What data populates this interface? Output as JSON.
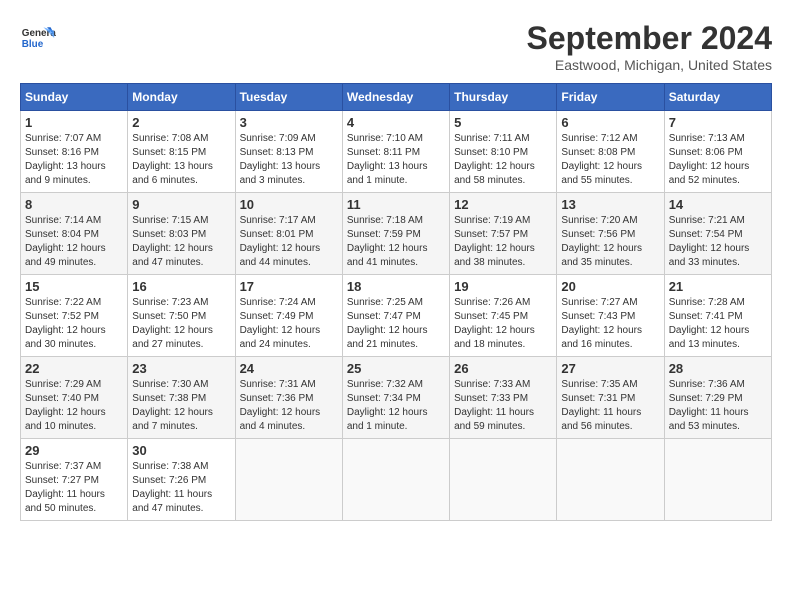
{
  "header": {
    "logo_line1": "General",
    "logo_line2": "Blue",
    "month": "September 2024",
    "location": "Eastwood, Michigan, United States"
  },
  "columns": [
    "Sunday",
    "Monday",
    "Tuesday",
    "Wednesday",
    "Thursday",
    "Friday",
    "Saturday"
  ],
  "weeks": [
    [
      {
        "day": "1",
        "detail": "Sunrise: 7:07 AM\nSunset: 8:16 PM\nDaylight: 13 hours\nand 9 minutes."
      },
      {
        "day": "2",
        "detail": "Sunrise: 7:08 AM\nSunset: 8:15 PM\nDaylight: 13 hours\nand 6 minutes."
      },
      {
        "day": "3",
        "detail": "Sunrise: 7:09 AM\nSunset: 8:13 PM\nDaylight: 13 hours\nand 3 minutes."
      },
      {
        "day": "4",
        "detail": "Sunrise: 7:10 AM\nSunset: 8:11 PM\nDaylight: 13 hours\nand 1 minute."
      },
      {
        "day": "5",
        "detail": "Sunrise: 7:11 AM\nSunset: 8:10 PM\nDaylight: 12 hours\nand 58 minutes."
      },
      {
        "day": "6",
        "detail": "Sunrise: 7:12 AM\nSunset: 8:08 PM\nDaylight: 12 hours\nand 55 minutes."
      },
      {
        "day": "7",
        "detail": "Sunrise: 7:13 AM\nSunset: 8:06 PM\nDaylight: 12 hours\nand 52 minutes."
      }
    ],
    [
      {
        "day": "8",
        "detail": "Sunrise: 7:14 AM\nSunset: 8:04 PM\nDaylight: 12 hours\nand 49 minutes."
      },
      {
        "day": "9",
        "detail": "Sunrise: 7:15 AM\nSunset: 8:03 PM\nDaylight: 12 hours\nand 47 minutes."
      },
      {
        "day": "10",
        "detail": "Sunrise: 7:17 AM\nSunset: 8:01 PM\nDaylight: 12 hours\nand 44 minutes."
      },
      {
        "day": "11",
        "detail": "Sunrise: 7:18 AM\nSunset: 7:59 PM\nDaylight: 12 hours\nand 41 minutes."
      },
      {
        "day": "12",
        "detail": "Sunrise: 7:19 AM\nSunset: 7:57 PM\nDaylight: 12 hours\nand 38 minutes."
      },
      {
        "day": "13",
        "detail": "Sunrise: 7:20 AM\nSunset: 7:56 PM\nDaylight: 12 hours\nand 35 minutes."
      },
      {
        "day": "14",
        "detail": "Sunrise: 7:21 AM\nSunset: 7:54 PM\nDaylight: 12 hours\nand 33 minutes."
      }
    ],
    [
      {
        "day": "15",
        "detail": "Sunrise: 7:22 AM\nSunset: 7:52 PM\nDaylight: 12 hours\nand 30 minutes."
      },
      {
        "day": "16",
        "detail": "Sunrise: 7:23 AM\nSunset: 7:50 PM\nDaylight: 12 hours\nand 27 minutes."
      },
      {
        "day": "17",
        "detail": "Sunrise: 7:24 AM\nSunset: 7:49 PM\nDaylight: 12 hours\nand 24 minutes."
      },
      {
        "day": "18",
        "detail": "Sunrise: 7:25 AM\nSunset: 7:47 PM\nDaylight: 12 hours\nand 21 minutes."
      },
      {
        "day": "19",
        "detail": "Sunrise: 7:26 AM\nSunset: 7:45 PM\nDaylight: 12 hours\nand 18 minutes."
      },
      {
        "day": "20",
        "detail": "Sunrise: 7:27 AM\nSunset: 7:43 PM\nDaylight: 12 hours\nand 16 minutes."
      },
      {
        "day": "21",
        "detail": "Sunrise: 7:28 AM\nSunset: 7:41 PM\nDaylight: 12 hours\nand 13 minutes."
      }
    ],
    [
      {
        "day": "22",
        "detail": "Sunrise: 7:29 AM\nSunset: 7:40 PM\nDaylight: 12 hours\nand 10 minutes."
      },
      {
        "day": "23",
        "detail": "Sunrise: 7:30 AM\nSunset: 7:38 PM\nDaylight: 12 hours\nand 7 minutes."
      },
      {
        "day": "24",
        "detail": "Sunrise: 7:31 AM\nSunset: 7:36 PM\nDaylight: 12 hours\nand 4 minutes."
      },
      {
        "day": "25",
        "detail": "Sunrise: 7:32 AM\nSunset: 7:34 PM\nDaylight: 12 hours\nand 1 minute."
      },
      {
        "day": "26",
        "detail": "Sunrise: 7:33 AM\nSunset: 7:33 PM\nDaylight: 11 hours\nand 59 minutes."
      },
      {
        "day": "27",
        "detail": "Sunrise: 7:35 AM\nSunset: 7:31 PM\nDaylight: 11 hours\nand 56 minutes."
      },
      {
        "day": "28",
        "detail": "Sunrise: 7:36 AM\nSunset: 7:29 PM\nDaylight: 11 hours\nand 53 minutes."
      }
    ],
    [
      {
        "day": "29",
        "detail": "Sunrise: 7:37 AM\nSunset: 7:27 PM\nDaylight: 11 hours\nand 50 minutes."
      },
      {
        "day": "30",
        "detail": "Sunrise: 7:38 AM\nSunset: 7:26 PM\nDaylight: 11 hours\nand 47 minutes."
      },
      {
        "day": "",
        "detail": ""
      },
      {
        "day": "",
        "detail": ""
      },
      {
        "day": "",
        "detail": ""
      },
      {
        "day": "",
        "detail": ""
      },
      {
        "day": "",
        "detail": ""
      }
    ]
  ]
}
